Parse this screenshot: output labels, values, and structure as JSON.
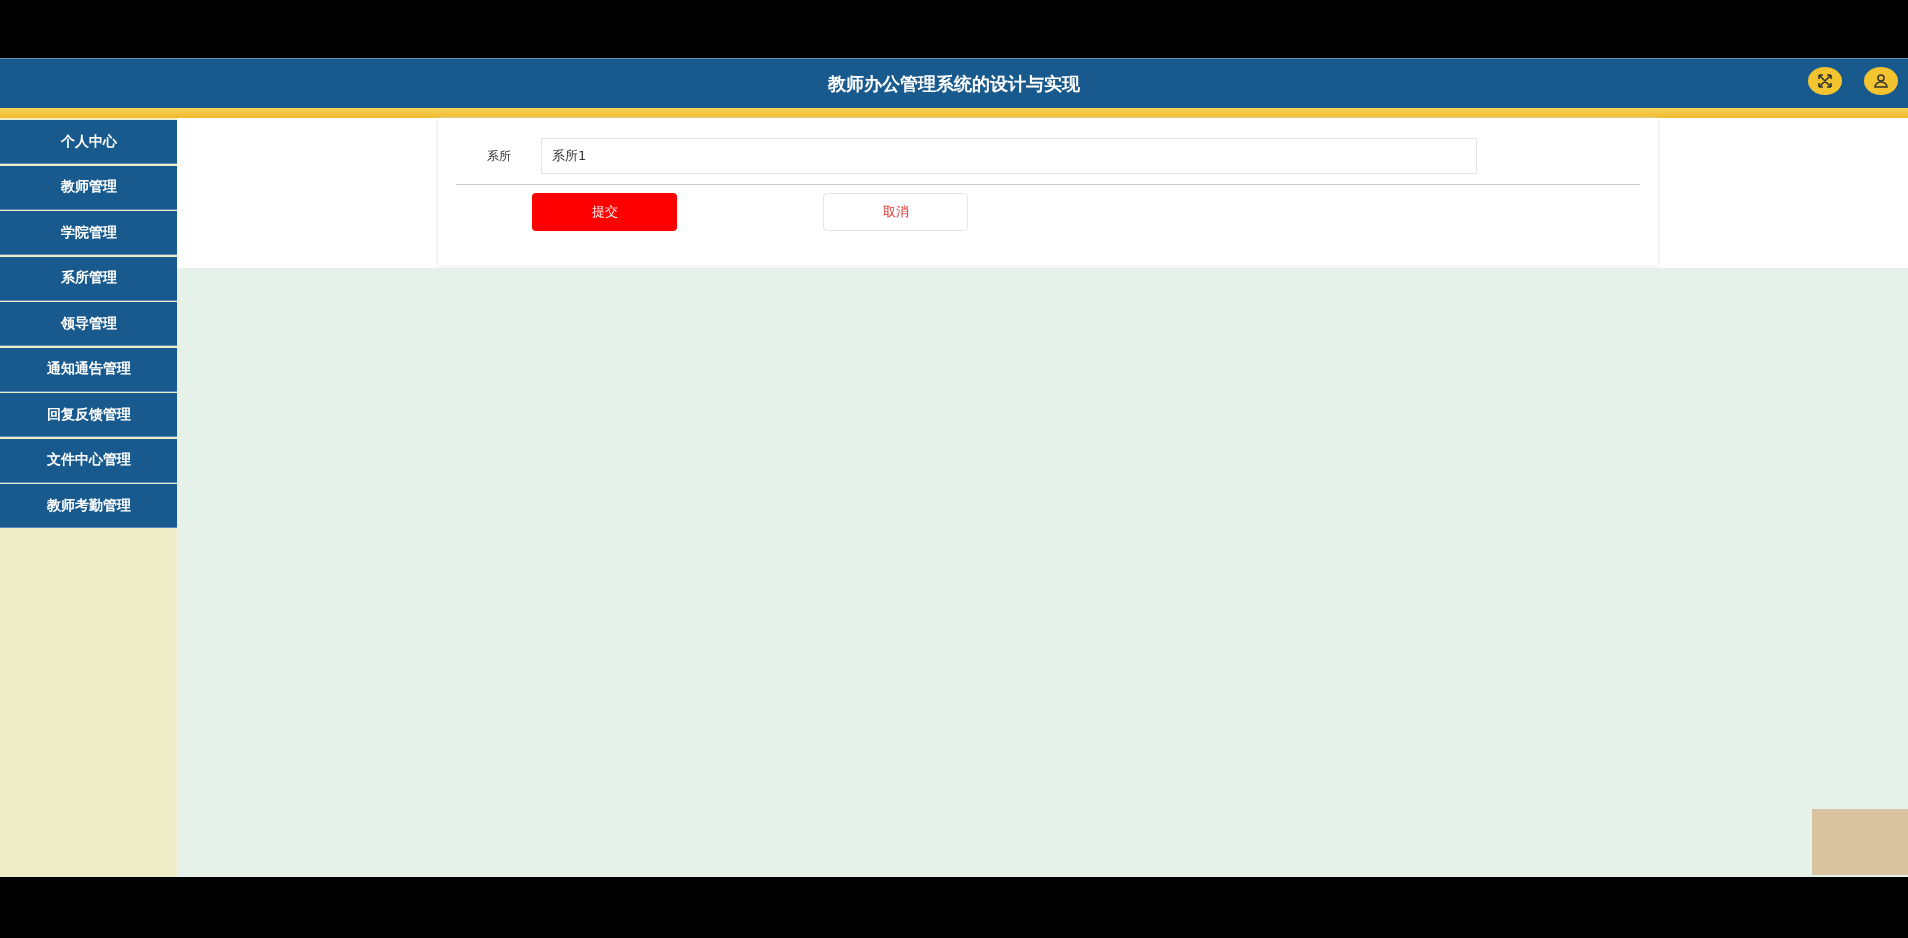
{
  "header": {
    "title": "教师办公管理系统的设计与实现"
  },
  "sidebar": {
    "items": [
      {
        "label": "个人中心"
      },
      {
        "label": "教师管理"
      },
      {
        "label": "学院管理"
      },
      {
        "label": "系所管理"
      },
      {
        "label": "领导管理"
      },
      {
        "label": "通知通告管理"
      },
      {
        "label": "回复反馈管理"
      },
      {
        "label": "文件中心管理"
      },
      {
        "label": "教师考勤管理"
      }
    ]
  },
  "form": {
    "fields": [
      {
        "label": "系所",
        "value": "系所1"
      }
    ],
    "buttons": [
      {
        "label": "提交",
        "kind": "primary"
      },
      {
        "label": "取消",
        "kind": "secondary"
      }
    ]
  }
}
